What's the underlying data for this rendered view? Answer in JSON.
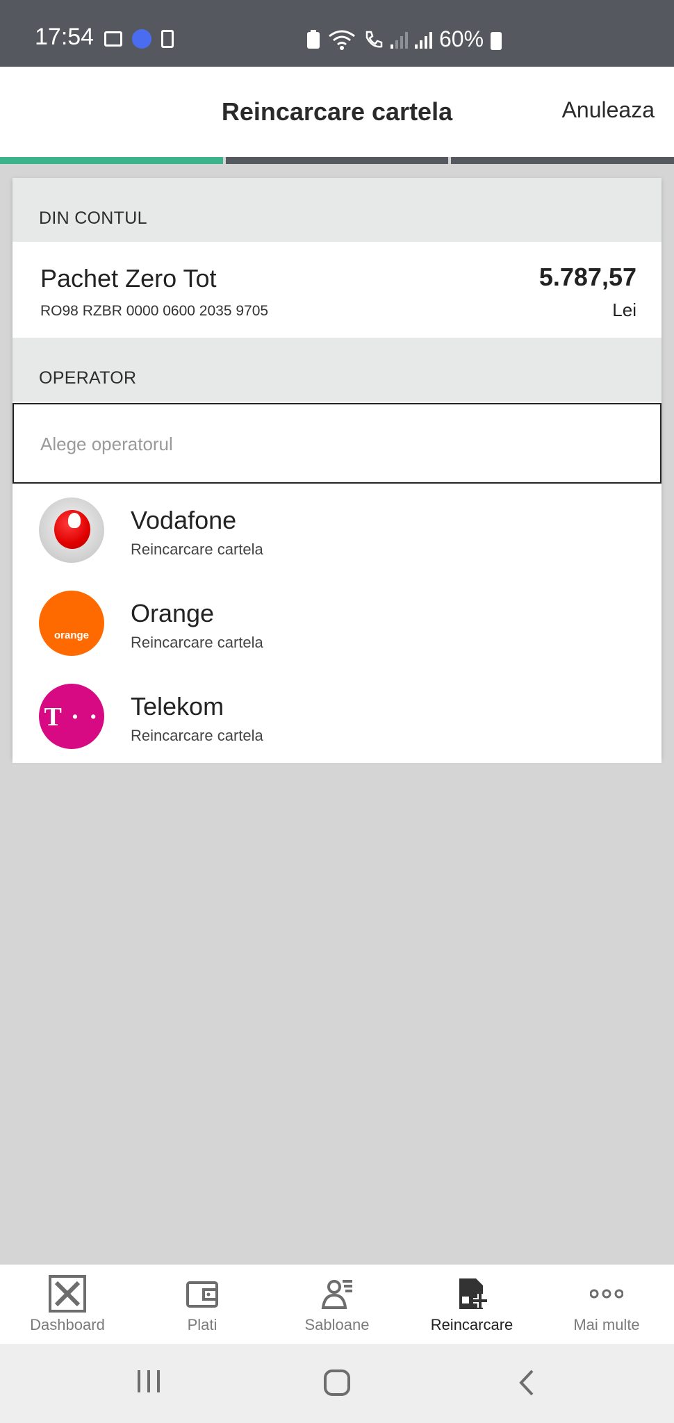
{
  "status_bar": {
    "time": "17:54",
    "battery": "60%"
  },
  "header": {
    "title": "Reincarcare cartela",
    "cancel_label": "Anuleaza"
  },
  "steps": {
    "total": 3,
    "current": 1
  },
  "account_section": {
    "heading": "DIN CONTUL",
    "account_name": "Pachet Zero Tot",
    "iban": "RO98 RZBR 0000 0600 2035 9705",
    "balance": "5.787,57",
    "currency": "Lei"
  },
  "operator_section": {
    "heading": "OPERATOR",
    "placeholder": "Alege operatorul",
    "operators": [
      {
        "name": "Vodafone",
        "subtitle": "Reincarcare cartela",
        "logo": "vodafone-logo"
      },
      {
        "name": "Orange",
        "subtitle": "Reincarcare cartela",
        "logo": "orange-logo",
        "logo_text": "orange"
      },
      {
        "name": "Telekom",
        "subtitle": "Reincarcare cartela",
        "logo": "telekom-logo",
        "logo_text": "T · ·"
      }
    ]
  },
  "bottom_nav": {
    "items": [
      {
        "label": "Dashboard",
        "icon": "dashboard-icon"
      },
      {
        "label": "Plati",
        "icon": "wallet-icon"
      },
      {
        "label": "Sabloane",
        "icon": "templates-icon"
      },
      {
        "label": "Reincarcare",
        "icon": "sim-add-icon",
        "active": true
      },
      {
        "label": "Mai multe",
        "icon": "more-icon"
      }
    ]
  },
  "colors": {
    "accent": "#3cb38a",
    "statusbar": "#55585e",
    "background": "#d5d5d5"
  }
}
